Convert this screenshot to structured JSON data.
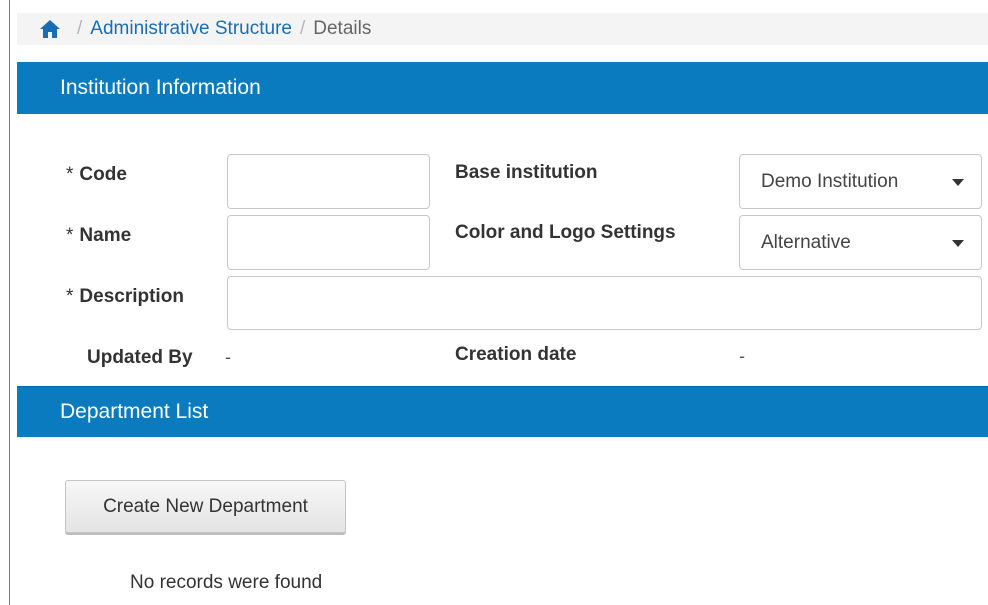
{
  "breadcrumb": {
    "home_icon": "home-icon",
    "items": [
      "Administrative Structure",
      "Details"
    ],
    "separator": "/"
  },
  "institution": {
    "header": "Institution Information",
    "code_label": "Code",
    "name_label": "Name",
    "description_label": "Description",
    "required_marker": "*",
    "updated_by_label": "Updated By",
    "updated_by_value": "-",
    "base_institution_label": "Base institution",
    "base_institution_value": "Demo Institution",
    "color_logo_label": "Color and Logo Settings",
    "color_logo_value": "Alternative",
    "creation_date_label": "Creation date",
    "creation_date_value": "-",
    "code_value": "",
    "name_value": "",
    "description_value": ""
  },
  "departments": {
    "header": "Department List",
    "create_button": "Create New Department",
    "empty_message": "No records were found"
  },
  "colors": {
    "header_bg": "#0b7bc0",
    "link": "#1a6db3"
  }
}
